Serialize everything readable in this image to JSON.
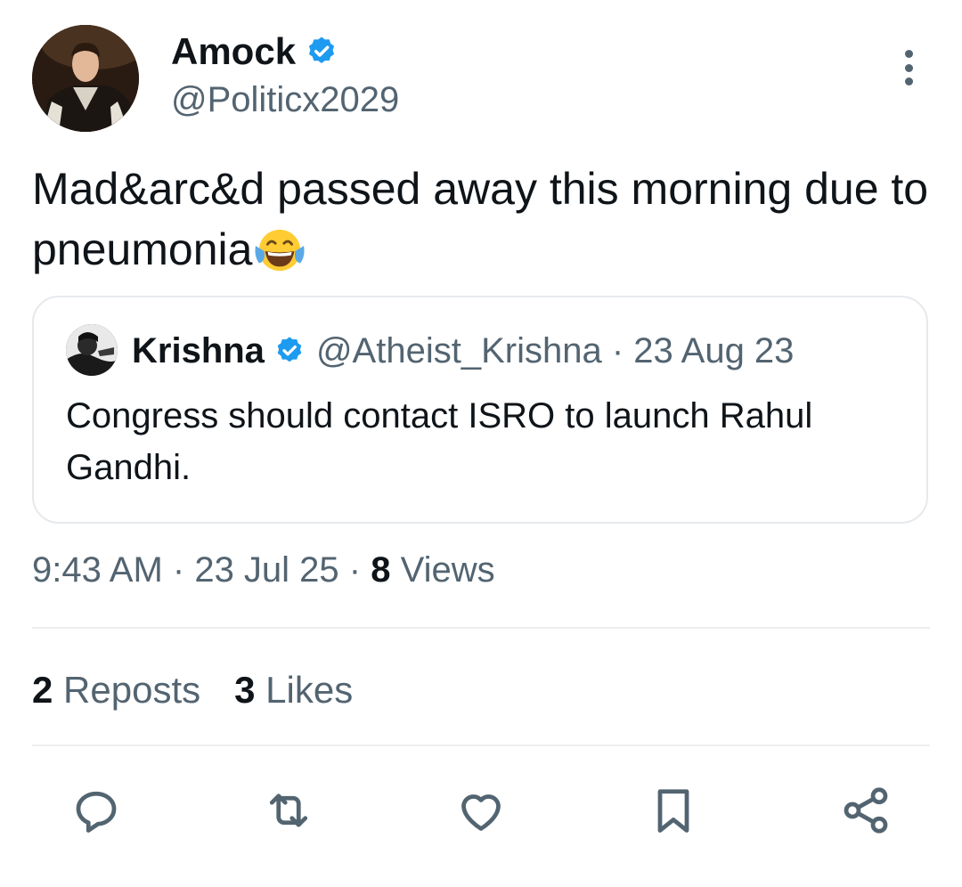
{
  "tweet": {
    "author": {
      "display_name": "Amock",
      "handle": "@Politicx2029",
      "verified": true,
      "avatar": "avatar-photo"
    },
    "text": "Mad&arc&d passed away this morning due to pneumonia",
    "emoji": "face-with-tears-of-joy",
    "timestamp_time": "9:43 AM",
    "timestamp_date": "23 Jul 25",
    "views_count": "8",
    "views_label": "Views",
    "reposts_count": "2",
    "reposts_label": "Reposts",
    "likes_count": "3",
    "likes_label": "Likes"
  },
  "quoted": {
    "display_name": "Krishna",
    "handle": "@Atheist_Krishna",
    "date": "23 Aug 23",
    "verified": true,
    "text": "Congress should contact ISRO to launch Rahul Gandhi."
  },
  "actions": [
    "reply-icon",
    "repost-icon",
    "like-icon",
    "bookmark-icon",
    "share-icon"
  ],
  "colors": {
    "verified": "#1d9bf0",
    "secondary_text": "#536471",
    "primary_text": "#0f1419",
    "border": "#e6e9ec"
  }
}
